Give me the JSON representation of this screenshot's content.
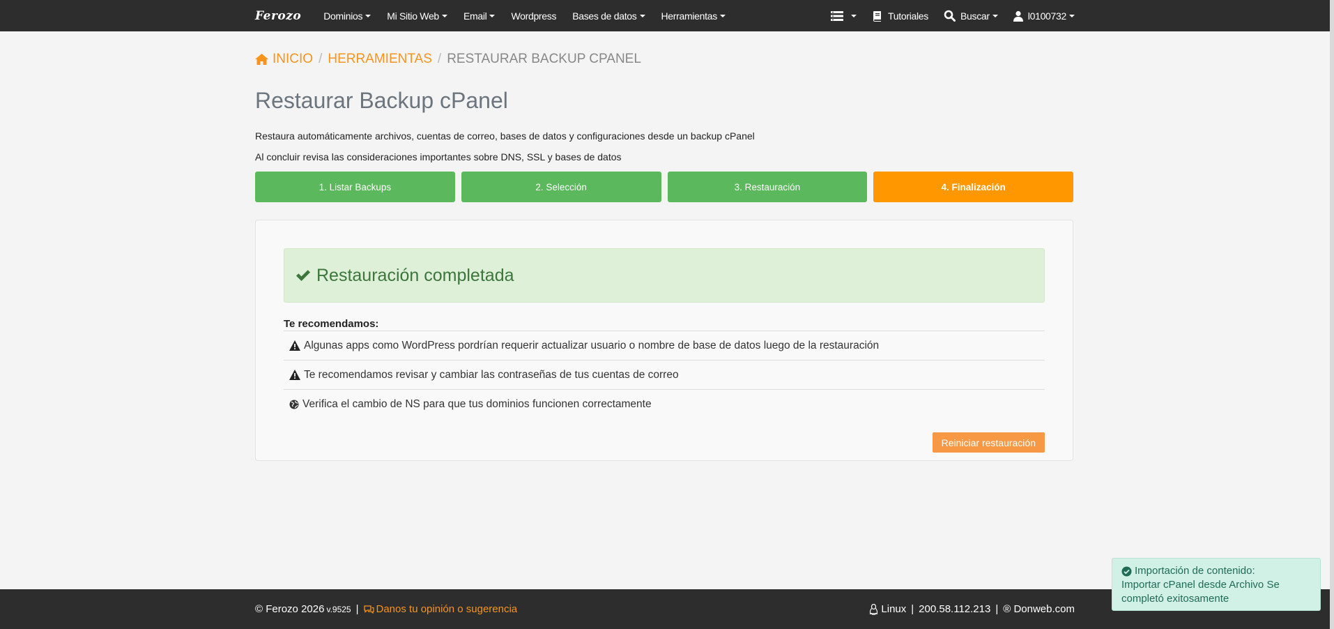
{
  "nav": {
    "logo": "Ferozo",
    "items": [
      "Dominios",
      "Mi Sitio Web",
      "Email",
      "Wordpress",
      "Bases de datos",
      "Herramientas"
    ],
    "tutorials": "Tutoriales",
    "search": "Buscar",
    "user": "l0100732"
  },
  "breadcrumb": {
    "home": "INICIO",
    "tools": "HERRAMIENTAS",
    "current": "RESTAURAR BACKUP CPANEL"
  },
  "page": {
    "title": "Restaurar Backup cPanel",
    "desc1": "Restaura automáticamente archivos, cuentas de correo, bases de datos y configuraciones desde un backup cPanel",
    "desc2": "Al concluir revisa las consideraciones importantes sobre DNS, SSL y bases de datos"
  },
  "steps": [
    "1. Listar Backups",
    "2. Selección",
    "3. Restauración",
    "4. Finalización"
  ],
  "result": {
    "alert": "Restauración completada",
    "rec_title": "Te recomendamos:",
    "recommendations": [
      "Algunas apps como WordPress pordrían requerir actualizar usuario o nombre de base de datos luego de la restauración",
      "Te recomendamos revisar y cambiar las contraseñas de tus cuentas de correo",
      "Verifica el cambio de NS para que tus dominios funcionen correctamente"
    ],
    "restart_button": "Reiniciar restauración"
  },
  "footer": {
    "copyright": "© Ferozo 2026",
    "version": "v.9525",
    "feedback": "Danos tu opinión o sugerencia",
    "os": "Linux",
    "ip": "200.58.112.213",
    "brand": "® Donweb.com"
  },
  "toast": {
    "title": "Importación de contenido:",
    "message": "Importar cPanel desde Archivo Se completó exitosamente"
  },
  "colors": {
    "accent": "#f7941d",
    "step_done": "#5cb85c",
    "step_active": "#ff9800",
    "success_bg": "#dff0d8",
    "success_text": "#3c763d",
    "navbar": "#2d2d2d"
  }
}
